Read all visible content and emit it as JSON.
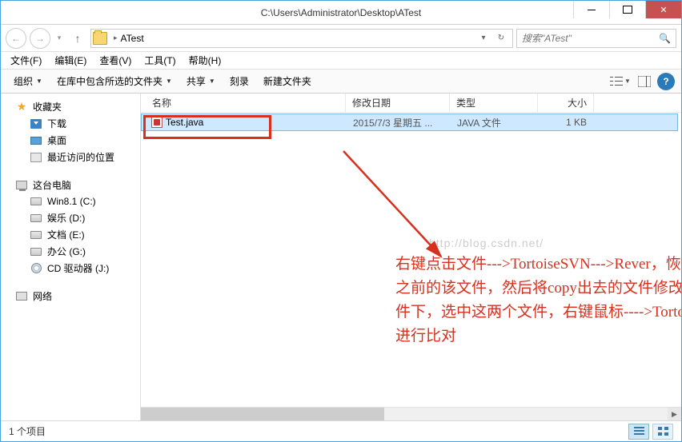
{
  "window": {
    "title": "C:\\Users\\Administrator\\Desktop\\ATest"
  },
  "breadcrumb": {
    "current": "ATest"
  },
  "search": {
    "placeholder": "搜索\"ATest\""
  },
  "menu": {
    "file": "文件(F)",
    "edit": "编辑(E)",
    "view": "查看(V)",
    "tools": "工具(T)",
    "help": "帮助(H)"
  },
  "toolbar": {
    "organize": "组织",
    "include": "在库中包含所选的文件夹",
    "share": "共享",
    "burn": "刻录",
    "newfolder": "新建文件夹"
  },
  "columns": {
    "name": "名称",
    "date": "修改日期",
    "type": "类型",
    "size": "大小"
  },
  "nav": {
    "favorites": "收藏夹",
    "downloads": "下载",
    "desktop": "桌面",
    "recent": "最近访问的位置",
    "thispc": "这台电脑",
    "drives": [
      "Win8.1 (C:)",
      "娱乐 (D:)",
      "文档 (E:)",
      "办公 (G:)",
      "CD 驱动器 (J:)"
    ],
    "network": "网络"
  },
  "files": [
    {
      "name": "Test.java",
      "date": "2015/7/3 星期五 ...",
      "type": "JAVA 文件",
      "size": "1 KB"
    }
  ],
  "status": {
    "count": "1 个项目"
  },
  "watermark": "http://blog.csdn.net/",
  "annotation": "右键点击文件--->TortoiseSVN--->Rever，恢复到自己没有修改之前的该文件，然后将copy出去的文件修改名称后移动到该文件下，选中这两个文件，右键鼠标---->TortoiseSVN--->Diff，进行比对"
}
